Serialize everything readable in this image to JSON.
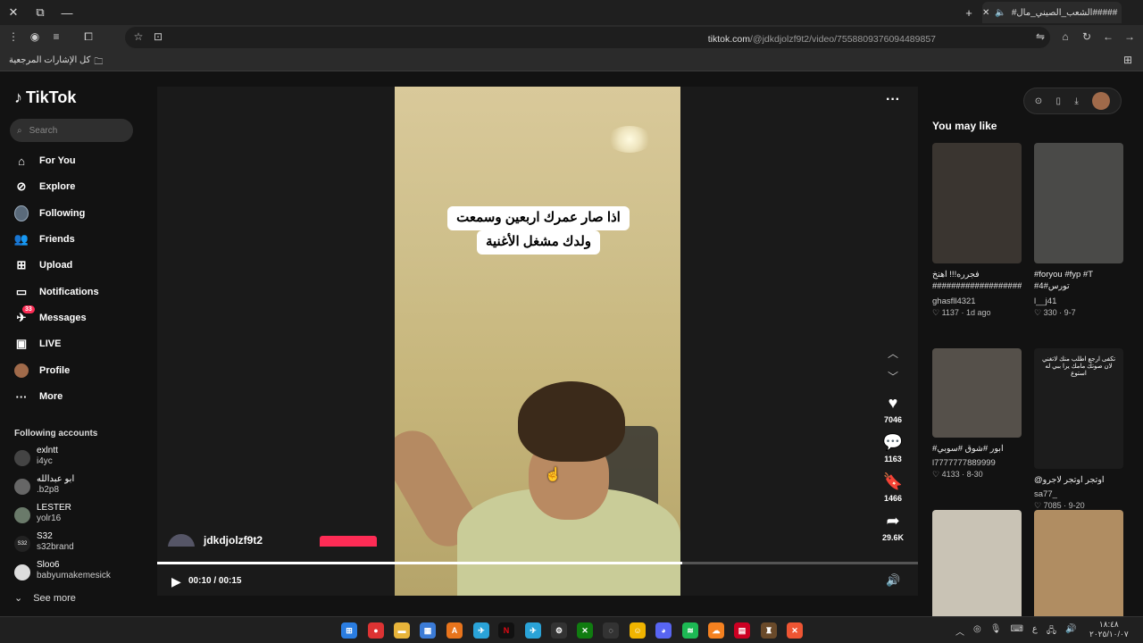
{
  "browser": {
    "tab_title": "#####الشعب_الصيني_مال#",
    "url_host": "tiktok.com",
    "url_path": "/@jdkdjolzf9t2/video/7558809376094489857",
    "bookmarks_all": "كل الإشارات المرجعية"
  },
  "sidebar": {
    "logo": "TikTok",
    "search_placeholder": "Search",
    "nav": [
      {
        "label": "For You",
        "icon": "home-icon"
      },
      {
        "label": "Explore",
        "icon": "compass-icon"
      },
      {
        "label": "Following",
        "icon": "following-avatar-icon"
      },
      {
        "label": "Friends",
        "icon": "friends-icon"
      },
      {
        "label": "Upload",
        "icon": "upload-icon"
      },
      {
        "label": "Notifications",
        "icon": "notifications-icon"
      },
      {
        "label": "Messages",
        "icon": "messages-icon",
        "badge": "33"
      },
      {
        "label": "LIVE",
        "icon": "live-icon"
      },
      {
        "label": "Profile",
        "icon": "profile-icon"
      },
      {
        "label": "More",
        "icon": "more-icon"
      }
    ],
    "following_title": "Following accounts",
    "accounts": [
      {
        "name": "exlntt",
        "handle": "i4yc"
      },
      {
        "name": "ابو عبدالله",
        "handle": ".b2p8"
      },
      {
        "name": "LESTER",
        "handle": "yolr16"
      },
      {
        "name": "S32",
        "handle": "s32brand",
        "avatar_text": "S32"
      },
      {
        "name": "Sloo6",
        "handle": "babyumakemesick"
      }
    ],
    "see_more": "See more"
  },
  "video": {
    "caption_line1": "اذا صار عمرك اربعين وسمعت",
    "caption_line2": "ولدك مشغل الأغنية",
    "time": "00:10 / 00:15",
    "progress": 0.69,
    "likes": "7046",
    "comments": "1163",
    "saves": "1466",
    "shares": "29.6K",
    "author": "jdkdjolzf9t2"
  },
  "you_may_like": {
    "title": "You may like",
    "cards": [
      {
        "caption": "فجرره!!! اهنخ",
        "caption2": "##########################",
        "user": "ghasfll4321",
        "likes": "1137",
        "date": "1d ago",
        "thumb_color": "#3a3530",
        "thumb_text": ""
      },
      {
        "caption": "#foryou #fyp #T",
        "caption2": "#4#تورس",
        "user": "l__j41",
        "likes": "330",
        "date": "9-7",
        "thumb_color": "#4a4a48",
        "thumb_text": ""
      },
      {
        "caption": "#ابور #شوق #سوبي",
        "caption2": "",
        "user": "l7777777889999",
        "likes": "4133",
        "date": "8-30",
        "thumb_color": "#55504a",
        "thumb_text": ""
      },
      {
        "caption": "@اوتجر اوتجر لاجرو",
        "caption2": "",
        "user": "sa77_",
        "likes": "7085",
        "date": "9-20",
        "thumb_color": "#1c1c1c",
        "thumb_text": "تكفى ارجع اطلب منك لاتغني لان صوتك مامك يرا ببي له استوع"
      },
      {
        "caption": "",
        "caption2": "",
        "user": "",
        "likes": "",
        "date": "",
        "thumb_color": "#c9c3b5",
        "thumb_text": ""
      },
      {
        "caption": "",
        "caption2": "",
        "user": "",
        "likes": "",
        "date": "",
        "thumb_color": "#b08d62",
        "thumb_text": ""
      }
    ]
  },
  "taskbar": {
    "time": "١٨:٤٨",
    "date": "٢٠٢٥/١٠/٠٧",
    "lang": "ع"
  }
}
